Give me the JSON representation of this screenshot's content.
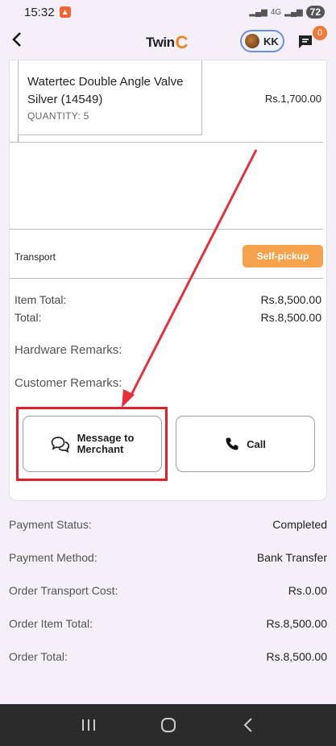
{
  "status_bar": {
    "time": "15:32",
    "network": "4G",
    "battery": "72"
  },
  "header": {
    "logo_text": "Twin",
    "logo_accent": "C",
    "profile_initials": "KK",
    "notification_count": "0"
  },
  "order_item": {
    "name": "Watertec Double Angle Valve Silver (14549)",
    "quantity": "QUANTITY: 5",
    "price": "Rs.1,700.00"
  },
  "transport": {
    "label": "Transport",
    "mode": "Self-pickup"
  },
  "summary": {
    "item_total_label": "Item Total:",
    "item_total_value": "Rs.8,500.00",
    "total_label": "Total:",
    "total_value": "Rs.8,500.00",
    "hardware_remarks_label": "Hardware Remarks:",
    "customer_remarks_label": "Customer Remarks:"
  },
  "actions": {
    "message_label_line1": "Message to",
    "message_label_line2": "Merchant",
    "call_label": "Call"
  },
  "order": {
    "payment_status_label": "Payment Status:",
    "payment_status_value": "Completed",
    "payment_method_label": "Payment Method:",
    "payment_method_value": "Bank Transfer",
    "transport_cost_label": "Order Transport Cost:",
    "transport_cost_value": "Rs.0.00",
    "item_total_label": "Order Item Total:",
    "item_total_value": "Rs.8,500.00",
    "total_label": "Order Total:",
    "total_value": "Rs.8,500.00"
  },
  "colors": {
    "accent_orange": "#f7a24c",
    "annotation_red": "#e0202a",
    "background": "#f4eff8"
  }
}
